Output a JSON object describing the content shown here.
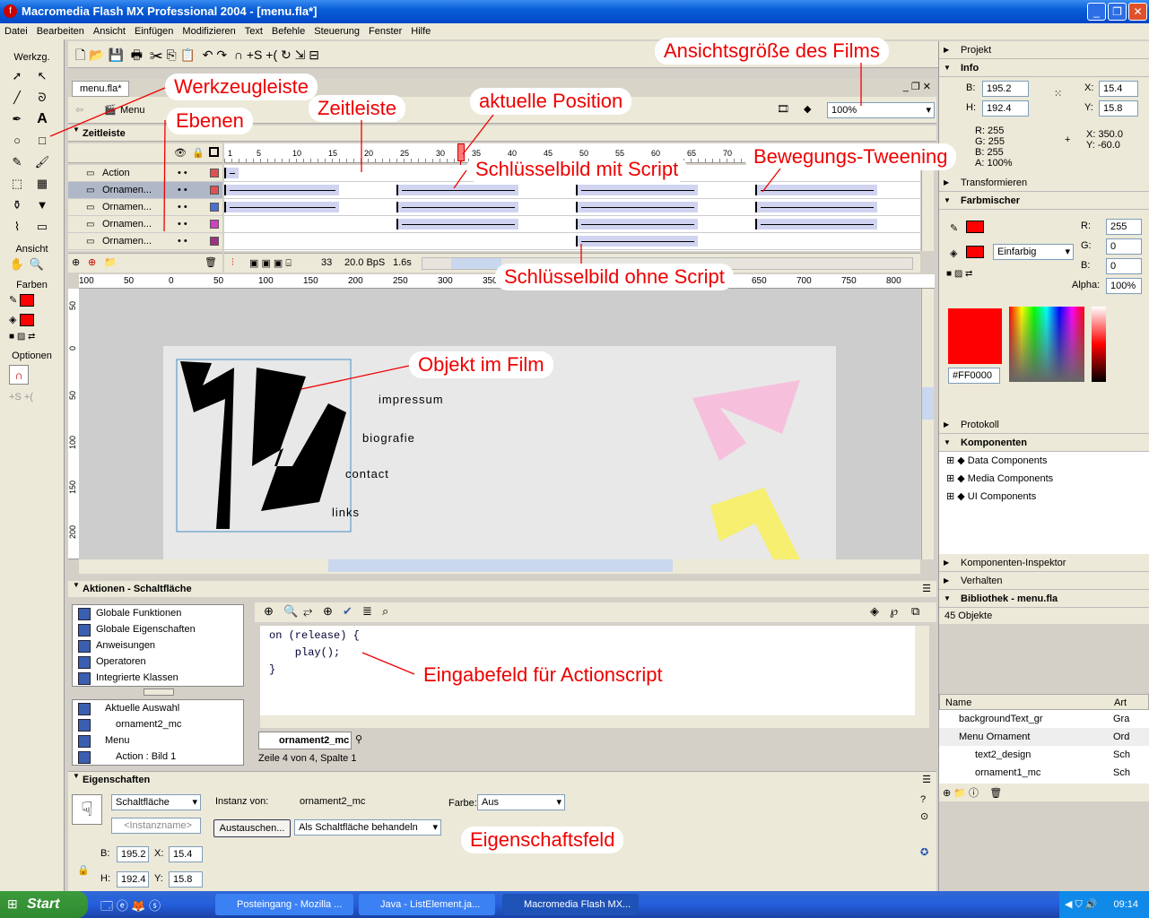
{
  "app": {
    "title": "Macromedia Flash MX Professional 2004 - [menu.fla*]"
  },
  "menu": [
    "Datei",
    "Bearbeiten",
    "Ansicht",
    "Einfügen",
    "Modifizieren",
    "Text",
    "Befehle",
    "Steuerung",
    "Fenster",
    "Hilfe"
  ],
  "tools": {
    "title": "Werkzg.",
    "view": "Ansicht",
    "colors": "Farben",
    "options": "Optionen"
  },
  "doc": {
    "tab": "menu.fla*",
    "scene": "Menu",
    "zoom": "100%"
  },
  "timeline": {
    "title": "Zeitleiste",
    "layers": [
      "Action",
      "Ornamen...",
      "Ornamen...",
      "Ornamen...",
      "Ornamen..."
    ],
    "frame_numbers": [
      "1",
      "5",
      "10",
      "15",
      "20",
      "25",
      "30",
      "35",
      "40",
      "45",
      "50",
      "55",
      "60",
      "65",
      "70"
    ],
    "current_frame": "33",
    "fps": "20.0 BpS",
    "time": "1.6s"
  },
  "ruler": {
    "h": [
      "100",
      "50",
      "0",
      "50",
      "100",
      "150",
      "200",
      "250",
      "300",
      "350",
      "400",
      "450",
      "500",
      "550",
      "600",
      "650",
      "700",
      "750",
      "800"
    ],
    "v": [
      "50",
      "0",
      "50",
      "100",
      "150",
      "200"
    ]
  },
  "stage": {
    "items": [
      "impressum",
      "biografie",
      "contact",
      "links"
    ]
  },
  "actions": {
    "title": "Aktionen - Schaltfläche",
    "categories": [
      "Globale Funktionen",
      "Globale Eigenschaften",
      "Anweisungen",
      "Operatoren",
      "Integrierte Klassen"
    ],
    "tree": [
      "Aktuelle Auswahl",
      "ornament2_mc",
      "Menu",
      "Action : Bild 1"
    ],
    "code": [
      "on (release) {",
      "    play();",
      "}"
    ],
    "tab": "ornament2_mc",
    "status": "Zeile 4 von 4, Spalte 1"
  },
  "props": {
    "title": "Eigenschaften",
    "type": "Schaltfläche",
    "instance_placeholder": "<Instanzname>",
    "instance_of_label": "Instanz von:",
    "instance_of": "ornament2_mc",
    "swap": "Austauschen...",
    "behavior": "Als Schaltfläche behandeln",
    "color_label": "Farbe:",
    "color": "Aus",
    "b_label": "B:",
    "b": "195.2",
    "x_label": "X:",
    "x": "15.4",
    "h_label": "H:",
    "h": "192.4",
    "y_label": "Y:",
    "y": "15.8"
  },
  "right": {
    "projekt": "Projekt",
    "info": "Info",
    "info_b": "195.2",
    "info_h": "192.4",
    "info_x": "15.4",
    "info_y": "15.8",
    "rgb": [
      "R: 255",
      "G: 255",
      "B: 255",
      "A: 100%"
    ],
    "cursor": [
      "X:  350.0",
      "Y:  -60.0"
    ],
    "transform": "Transformieren",
    "mixer": "Farbmischer",
    "r": "255",
    "g": "0",
    "b": "0",
    "alpha": "100%",
    "fill": "Einfarbig",
    "hex": "#FF0000",
    "protokoll": "Protokoll",
    "komponenten": "Komponenten",
    "components": [
      "Data Components",
      "Media Components",
      "UI Components"
    ],
    "inspector": "Komponenten-Inspektor",
    "verhalten": "Verhalten",
    "library": "Bibliothek - menu.fla",
    "count": "45 Objekte",
    "lib_cols": [
      "Name",
      "Art"
    ],
    "lib_items": [
      [
        "backgroundText_gr",
        "Gra"
      ],
      [
        "Menu Ornament",
        "Ord"
      ],
      [
        "text2_design",
        "Sch"
      ],
      [
        "ornament1_mc",
        "Sch"
      ]
    ],
    "r_label": "R:",
    "g_label": "G:",
    "b_label": "B:",
    "alpha_label": "Alpha:",
    "b_dim": "B:",
    "h_dim": "H:",
    "x_dim": "X:",
    "y_dim": "Y:"
  },
  "notes": [
    "Werkzeugleiste",
    "Ebenen",
    "Zeitleiste",
    "aktuelle Position",
    "Ansichtsgröße des Films",
    "Schlüsselbild mit Script",
    "Bewegungs-Tweening",
    "Schlüsselbild ohne Script",
    "Objekt im Film",
    "Eingabefeld für Actionscript",
    "Eigenschaftsfeld"
  ],
  "taskbar": {
    "start": "Start",
    "tasks": [
      "Posteingang - Mozilla ...",
      "Java - ListElement.ja...",
      "Macromedia Flash MX..."
    ],
    "clock": "09:14"
  }
}
